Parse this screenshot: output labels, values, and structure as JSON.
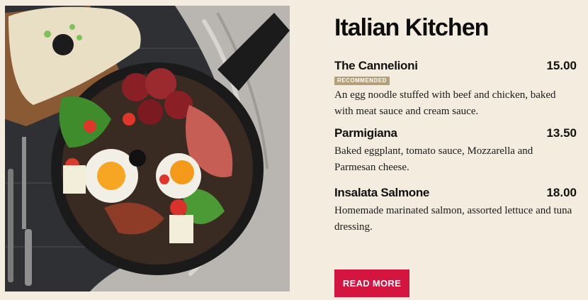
{
  "photo": {
    "alt_name": "pan-with-eggs-and-salami"
  },
  "menu": {
    "title": "Italian Kitchen",
    "items": [
      {
        "name": "The Cannelioni",
        "price": "15.00",
        "badge": "RECOMMENDED",
        "description": "An egg noodle stuffed with beef and chicken, baked with meat sauce and cream sauce."
      },
      {
        "name": "Parmigiana",
        "price": "13.50",
        "description": "Baked eggplant, tomato sauce, Mozzarella and Parmesan cheese."
      },
      {
        "name": "Insalata Salmone",
        "price": "18.00",
        "description": "Homemade marinated salmon, assorted lettuce and tuna dressing."
      }
    ],
    "read_more_label": "READ MORE"
  },
  "colors": {
    "background": "#f4eddf",
    "accent": "#d4153f",
    "badge": "#b59f79"
  }
}
